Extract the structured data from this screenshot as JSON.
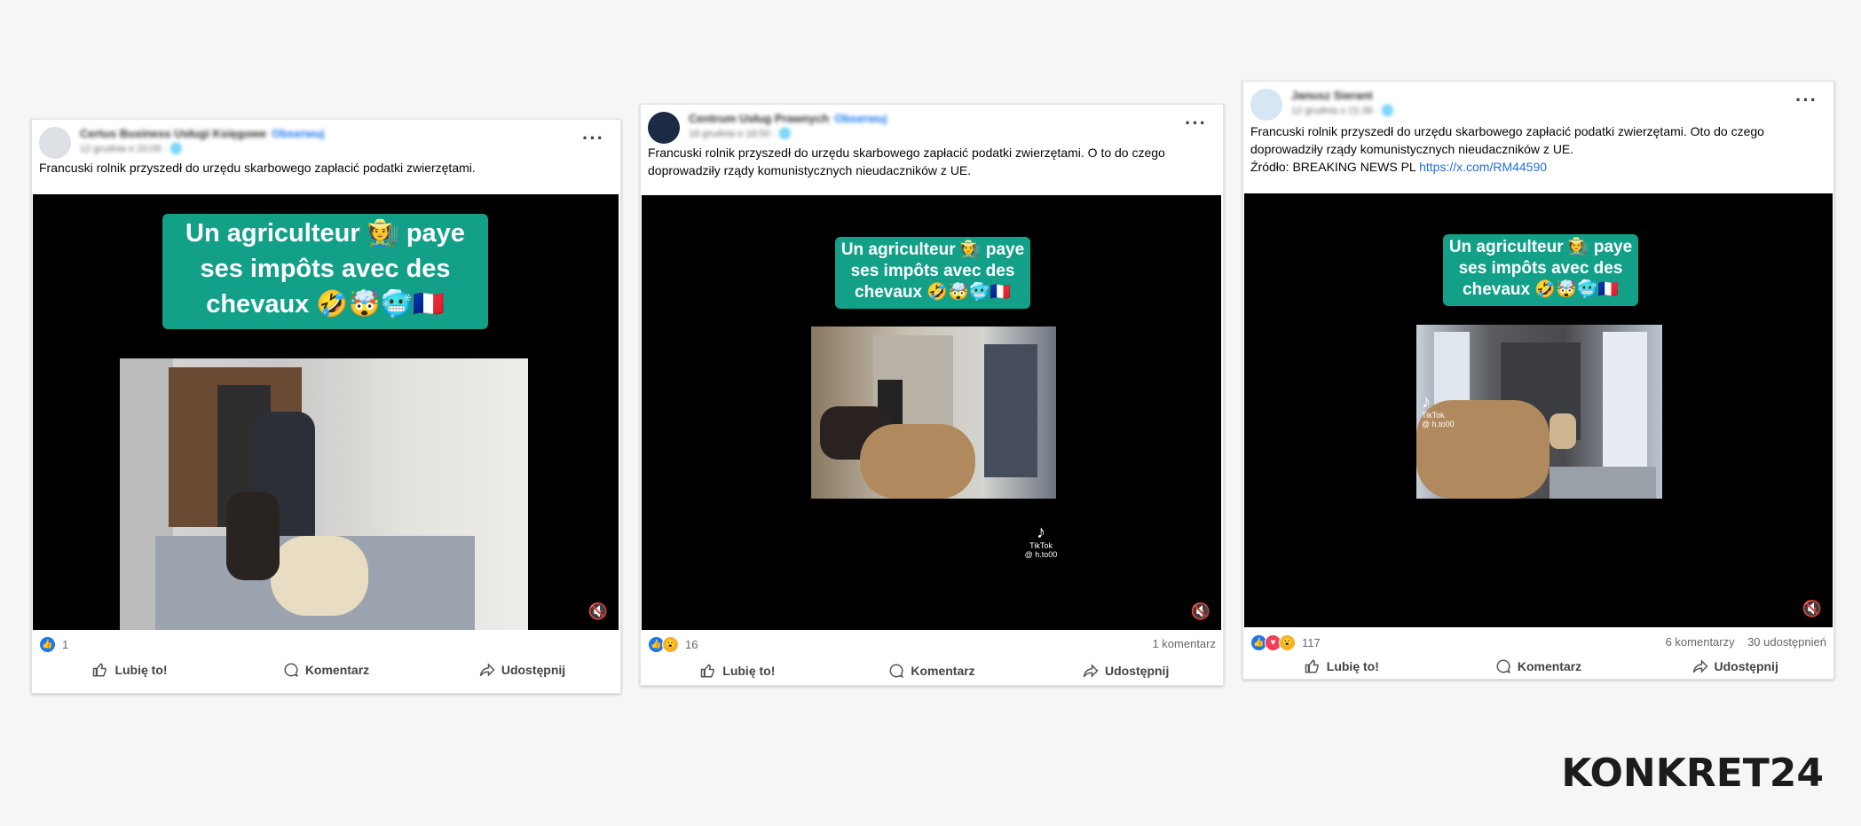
{
  "posts": [
    {
      "author": "Certus Business Usługi Księgowe",
      "follow": "Obserwuj",
      "meta": "12 grudnia o 20:05 · 🌐",
      "text": "Francuski rolnik przyszedł do urzędu skarbowego zapłacić podatki zwierzętami.",
      "link": "",
      "caption_line1": "Un agriculteur 🧑‍🌾 paye",
      "caption_line2": "ses impôts avec des",
      "caption_line3": "chevaux 🤣🤯🥶🇫🇷",
      "reaction_count": "1",
      "comments": "",
      "shares": "",
      "actions": {
        "like": "Lubię to!",
        "comment": "Komentarz",
        "share": "Udostępnij"
      }
    },
    {
      "author": "Centrum Usług Prawnych",
      "follow": "Obserwuj",
      "meta": "18 grudnia o 18:50 · 🌐",
      "text": "Francuski rolnik przyszedł do urzędu skarbowego zapłacić podatki zwierzętami. O to do czego doprowadziły rządy komunistycznych nieudaczników z UE.",
      "link": "",
      "caption_line1": "Un agriculteur 🧑‍🌾 paye",
      "caption_line2": "ses impôts avec des",
      "caption_line3": "chevaux 🤣🤯🥶🇫🇷",
      "tiktok_label": "TikTok",
      "tiktok_handle": "@ h.to00",
      "reaction_count": "16",
      "comments": "1 komentarz",
      "shares": "",
      "actions": {
        "like": "Lubię to!",
        "comment": "Komentarz",
        "share": "Udostępnij"
      }
    },
    {
      "author": "Janusz Sierant",
      "follow": "",
      "meta": "12 grudnia o 21:36 · 🌐",
      "text": "Francuski rolnik przyszedł do urzędu skarbowego zapłacić podatki zwierzętami. Oto do czego doprowadziły rządy komunistycznych nieudaczników z UE.\nŹródło: BREAKING NEWS PL ",
      "link": "https://x.com/RM44590",
      "caption_line1": "Un agriculteur 🧑‍🌾 paye",
      "caption_line2": "ses impôts avec des",
      "caption_line3": "chevaux 🤣🤯🥶🇫🇷",
      "tiktok_label": "TikTok",
      "tiktok_handle": "@ h.to00",
      "reaction_count": "117",
      "comments": "6 komentarzy",
      "shares": "30 udostępnień",
      "actions": {
        "like": "Lubię to!",
        "comment": "Komentarz",
        "share": "Udostępnij"
      }
    }
  ],
  "brand": "KONKRET24",
  "icons": {
    "more": "more-dots-icon",
    "mute": "mute-icon",
    "like": "thumbs-up-icon",
    "comment": "comment-icon",
    "share": "share-icon"
  },
  "colors": {
    "caption_bg": "#12a089",
    "link": "#216fdb",
    "like": "#1877f2"
  }
}
